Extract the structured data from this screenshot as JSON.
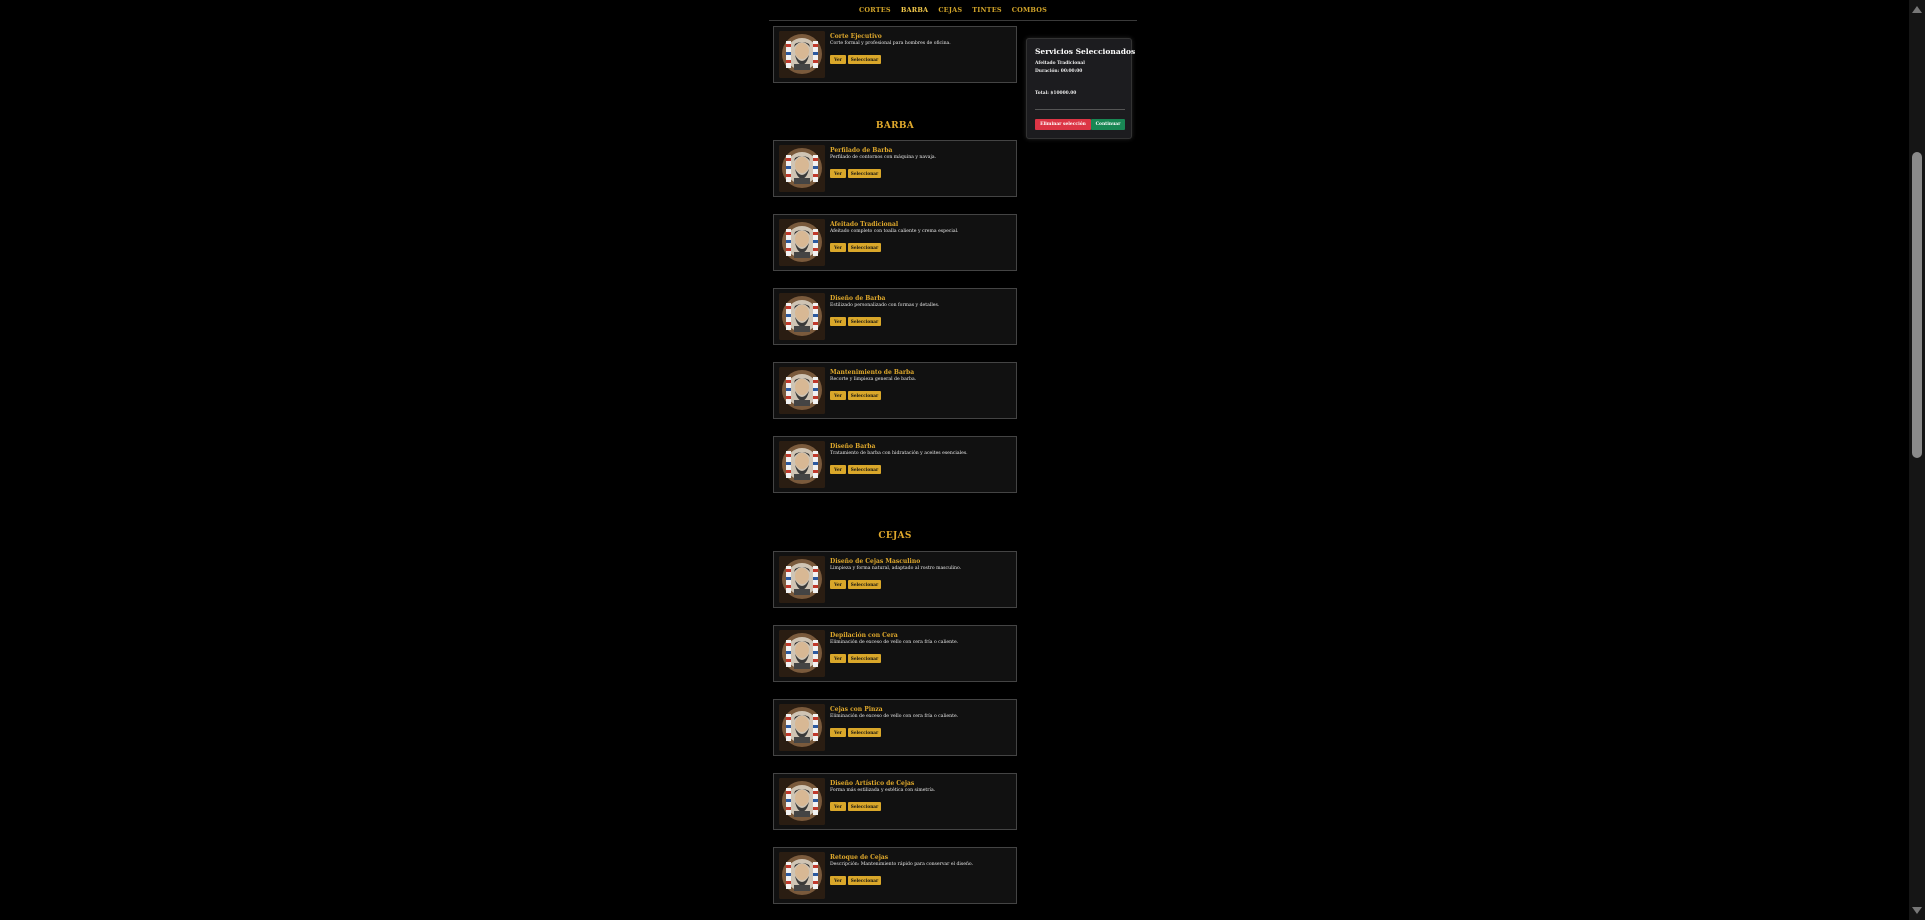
{
  "nav": {
    "items": [
      {
        "label": "CORTES",
        "active": false
      },
      {
        "label": "BARBA",
        "active": true
      },
      {
        "label": "CEJAS",
        "active": false
      },
      {
        "label": "TINTES",
        "active": false
      },
      {
        "label": "COMBOS",
        "active": false
      }
    ]
  },
  "buttons": {
    "ver": "Ver",
    "seleccionar": "Seleccionar"
  },
  "sections": {
    "cortes_partial": [
      {
        "title": "Corte Ejecutivo",
        "desc": "Corte formal y profesional para hombres de oficina."
      }
    ],
    "barba": {
      "heading": "BARBA",
      "items": [
        {
          "title": "Perfilado de Barba",
          "desc": "Perfilado de contornos con máquina y navaja."
        },
        {
          "title": "Afeitado Tradicional",
          "desc": "Afeitado completo con toalla caliente y crema especial."
        },
        {
          "title": "Diseño de Barba",
          "desc": "Estilizado personalizado con formas y detalles."
        },
        {
          "title": "Mantenimiento de Barba",
          "desc": "Recorte y limpieza general de barba."
        },
        {
          "title": "Diseño Barba",
          "desc": "Tratamiento de barba con hidratación y aceites esenciales."
        }
      ]
    },
    "cejas": {
      "heading": "CEJAS",
      "items": [
        {
          "title": "Diseño de Cejas Masculino",
          "desc": "Limpieza y forma natural, adaptado al rostro masculino."
        },
        {
          "title": "Depilación con Cera",
          "desc": "Eliminación de exceso de vello con cera fría o caliente."
        },
        {
          "title": "Cejas con Pinza",
          "desc": "Eliminación de exceso de vello con cera fría o caliente."
        },
        {
          "title": "Diseño Artístico de Cejas",
          "desc": "Forma más estilizada y estética con simetría."
        },
        {
          "title": "Retoque de Cejas",
          "desc": "Descripción: Mantenimiento rápido para conservar el diseño."
        }
      ]
    }
  },
  "summary": {
    "title": "Servicios Seleccionados",
    "service": "Afeitado Tradicional",
    "duration": "Duración: 00:00:00",
    "total": "Total: $10000.00",
    "clear_label": "Eliminar selección",
    "continue_label": "Continuar"
  },
  "colors": {
    "accent": "#d9a72a",
    "danger": "#dc3545",
    "success": "#198754",
    "background": "#000000"
  }
}
